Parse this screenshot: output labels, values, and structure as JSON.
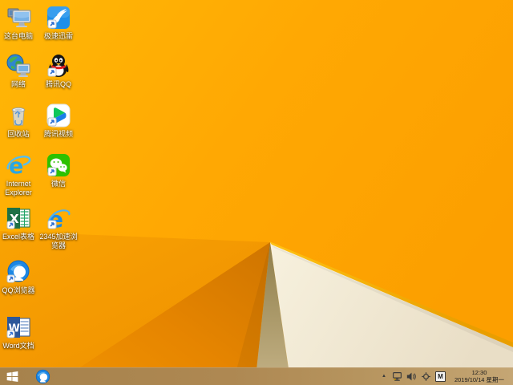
{
  "desktop": {
    "icons": [
      {
        "name": "this-pc",
        "label": "这台电脑"
      },
      {
        "name": "xunlei",
        "label": "极速迅雷"
      },
      {
        "name": "network",
        "label": "网络"
      },
      {
        "name": "tencent-qq",
        "label": "腾讯QQ"
      },
      {
        "name": "recycle-bin",
        "label": "回收站"
      },
      {
        "name": "tencent-video",
        "label": "腾讯视频"
      },
      {
        "name": "internet-explorer",
        "label": "Internet Explorer"
      },
      {
        "name": "wechat",
        "label": "微信"
      },
      {
        "name": "excel",
        "label": "Excel表格"
      },
      {
        "name": "browser-2345",
        "label": "2345加速浏览器"
      },
      {
        "name": "qq-browser",
        "label": "QQ浏览器"
      },
      {
        "name": "word",
        "label": "Word文档"
      }
    ]
  },
  "taskbar": {
    "pinned": [
      {
        "name": "qq-browser"
      }
    ],
    "tray": {
      "ime": "M",
      "time": "12:30",
      "date": "2019/10/14 星期一"
    }
  },
  "colors": {
    "wallpaper_orange": "#ffa602",
    "wallpaper_dark_orange": "#e08000",
    "wallpaper_khaki": "#b1a06d",
    "wallpaper_cream": "#f2ebd6",
    "edge_highlight": "#ffbb0e",
    "taskbar": "#ae8852"
  }
}
